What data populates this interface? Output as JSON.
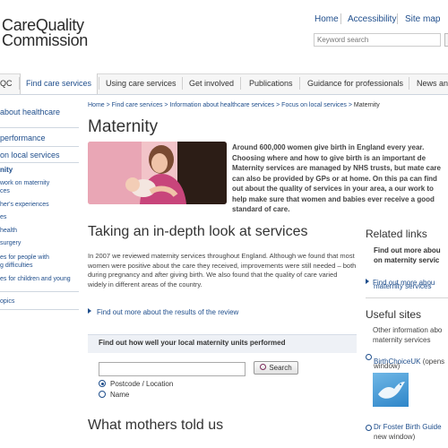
{
  "header": {
    "logo_line1": "CareQuality",
    "logo_line2": "Commission",
    "utility_links": [
      "Home",
      "Accessibility",
      "Site map"
    ],
    "search_placeholder": "Keyword search"
  },
  "nav": {
    "items": [
      "QC",
      "Find care services",
      "Using care services",
      "Get involved",
      "Publications",
      "Guidance for professionals",
      "News and"
    ],
    "active_index": 1
  },
  "sidebar": {
    "heading": "about healthcare",
    "items": [
      {
        "label": "performance",
        "active": false
      },
      {
        "label": "on local services",
        "active": false
      },
      {
        "label": "nity",
        "active": true
      },
      {
        "label": "work on maternity",
        "active": false
      },
      {
        "label": "ces",
        "active": false
      },
      {
        "label": "her's experiences",
        "active": false
      },
      {
        "label": "es",
        "active": false
      },
      {
        "label": "health",
        "active": false
      },
      {
        "label": "surgery",
        "active": false
      },
      {
        "label": "es for people with",
        "active": false
      },
      {
        "label": "g difficulties",
        "active": false
      },
      {
        "label": "es for children and young",
        "active": false
      },
      {
        "label": "opics",
        "active": false
      }
    ]
  },
  "breadcrumb": {
    "items": [
      "Home",
      "Find care services",
      "Information about healthcare services",
      "Focus on local services"
    ],
    "current": "Maternity"
  },
  "page": {
    "title": "Maternity",
    "intro": "Around 600,000 women give birth in England every year. Choosing where and how to give birth is an important de Maternity services are managed by NHS trusts, but mate care can also be provided by GPs or at home. On this pa can find out about the quality of services in your area, a our work to help make sure that women and babies ever receive a good standard of care.",
    "section1_heading": "Taking an in-depth look at services",
    "section1_text": "In 2007 we reviewed maternity services throughout England. Although we found that most women were positive about the care they received, improvements were still needed – both during pregnancy and after giving birth. We also found that the quality of care varied widely in different areas of the country.",
    "review_link": "Find out more about the results of the review",
    "find_box_title": "Find out how well your local maternity units performed",
    "search_button": "Search",
    "radio_options": [
      {
        "label": "Postcode / Location",
        "selected": true
      },
      {
        "label": "Name",
        "selected": false
      }
    ],
    "section2_heading": "What mothers told us"
  },
  "right": {
    "related_heading": "Related links",
    "related_bold_1": "Find out more abou",
    "related_bold_2": "on maternity servic",
    "related_link_1": "Find out more abou",
    "related_link_2": "maternity services",
    "useful_heading": "Useful sites",
    "useful_text_1": "Other information abo",
    "useful_text_2": "maternity services",
    "site1_line1": "BirthChoiceUK",
    "site1_suffix": " (opens",
    "site1_line2": "window)",
    "site2_line1": "Dr Foster Birth Guide",
    "site2_line2": "new window)"
  },
  "colors": {
    "link": "#1f4e8c",
    "nav_bg": "#f6f6f6",
    "find_box_bg": "#eef1f6"
  }
}
